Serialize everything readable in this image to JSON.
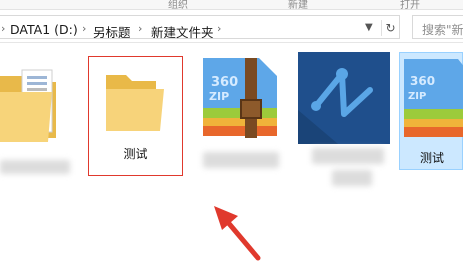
{
  "ribbon": {
    "groups": [
      "组织",
      "新建",
      "打开"
    ]
  },
  "address_bar": {
    "breadcrumbs": [
      "DATA1 (D:)",
      "另标题",
      "新建文件夹"
    ],
    "separator": "›"
  },
  "search": {
    "placeholder": "搜索\"新建"
  },
  "items": [
    {
      "name": "",
      "icon": "folder-with-documents-icon",
      "blurred_label": true
    },
    {
      "name": "测试",
      "icon": "folder-icon",
      "selected": true
    },
    {
      "name": "",
      "icon": "360zip-archive-icon",
      "blurred_label": true
    },
    {
      "name": "",
      "icon": "app-z-icon",
      "blurred_label": true
    },
    {
      "name": "测试",
      "icon": "360zip-archive-icon",
      "highlighted": true
    }
  ],
  "annotation": {
    "icon": "red-arrow-icon",
    "color": "#e0392d"
  },
  "colors": {
    "accent_red": "#e0392d",
    "folder_yellow": "#f5cf6a",
    "zip_blue": "#5ea7e8",
    "app_dark_blue": "#1f4f8c"
  }
}
